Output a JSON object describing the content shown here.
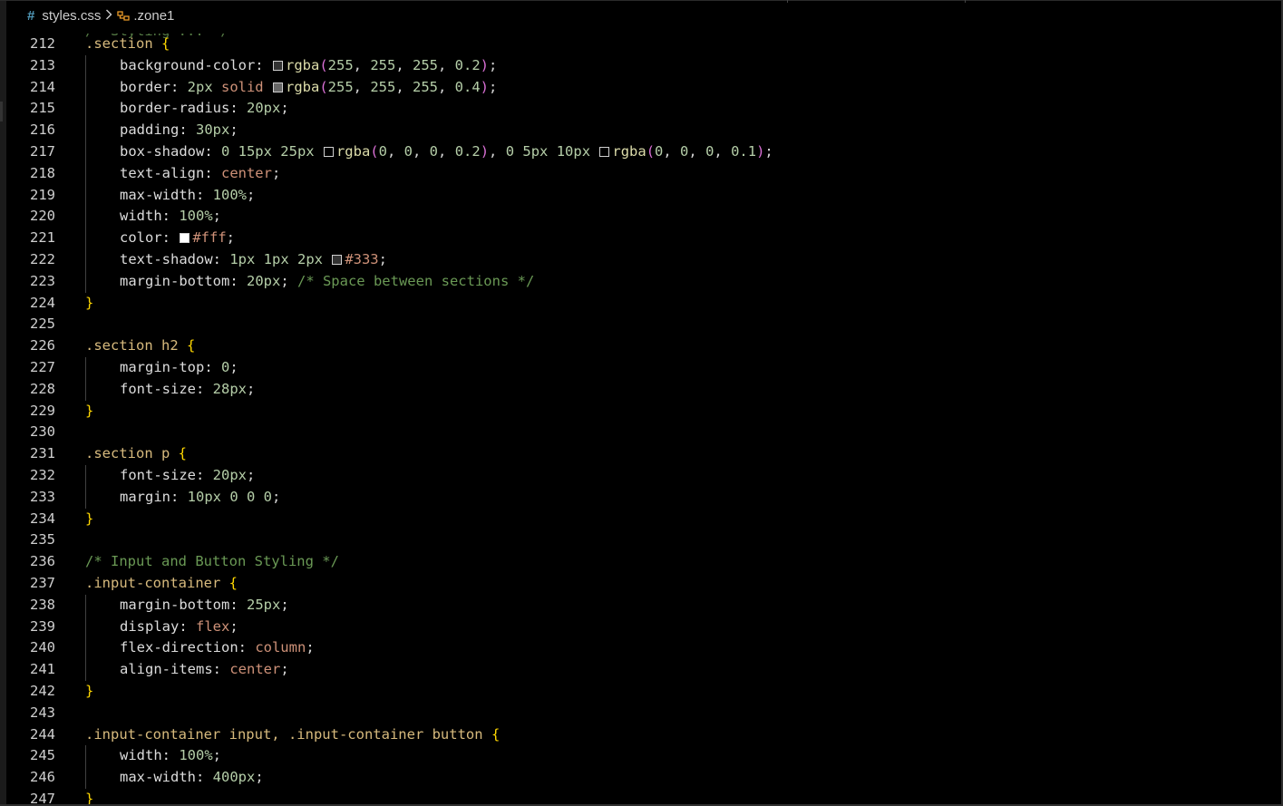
{
  "breadcrumb": {
    "file": "styles.css",
    "symbol": ".zone1"
  },
  "colors": {
    "background": "#000000",
    "selector": "#d7ba7d",
    "brace": "#ffd700",
    "number": "#b5cea8",
    "keyword": "#ce9178",
    "function": "#dcdcaa",
    "comment": "#6a9955"
  },
  "lines": [
    {
      "n": "212",
      "indent": 0,
      "t": [
        [
          "sel",
          ".section "
        ],
        [
          "brace",
          "{"
        ]
      ]
    },
    {
      "n": "213",
      "indent": 1,
      "t": [
        [
          "prop",
          "background-color: "
        ],
        [
          "sw",
          "rgba(255,255,255,0.2)"
        ],
        [
          "fn",
          "rgba"
        ],
        [
          "paren",
          "("
        ],
        [
          "num",
          "255"
        ],
        [
          "punc",
          ", "
        ],
        [
          "num",
          "255"
        ],
        [
          "punc",
          ", "
        ],
        [
          "num",
          "255"
        ],
        [
          "punc",
          ", "
        ],
        [
          "num",
          "0.2"
        ],
        [
          "paren",
          ")"
        ],
        [
          "punc",
          ";"
        ]
      ]
    },
    {
      "n": "214",
      "indent": 1,
      "t": [
        [
          "prop",
          "border: "
        ],
        [
          "num",
          "2px "
        ],
        [
          "kw",
          "solid "
        ],
        [
          "sw",
          "rgba(255,255,255,0.4)"
        ],
        [
          "fn",
          "rgba"
        ],
        [
          "paren",
          "("
        ],
        [
          "num",
          "255"
        ],
        [
          "punc",
          ", "
        ],
        [
          "num",
          "255"
        ],
        [
          "punc",
          ", "
        ],
        [
          "num",
          "255"
        ],
        [
          "punc",
          ", "
        ],
        [
          "num",
          "0.4"
        ],
        [
          "paren",
          ")"
        ],
        [
          "punc",
          ";"
        ]
      ]
    },
    {
      "n": "215",
      "indent": 1,
      "t": [
        [
          "prop",
          "border-radius: "
        ],
        [
          "num",
          "20px"
        ],
        [
          "punc",
          ";"
        ]
      ]
    },
    {
      "n": "216",
      "indent": 1,
      "t": [
        [
          "prop",
          "padding: "
        ],
        [
          "num",
          "30px"
        ],
        [
          "punc",
          ";"
        ]
      ]
    },
    {
      "n": "217",
      "indent": 1,
      "t": [
        [
          "prop",
          "box-shadow: "
        ],
        [
          "num",
          "0 15px 25px "
        ],
        [
          "sw",
          "rgba(0,0,0,0.2)"
        ],
        [
          "fn",
          "rgba"
        ],
        [
          "paren",
          "("
        ],
        [
          "num",
          "0"
        ],
        [
          "punc",
          ", "
        ],
        [
          "num",
          "0"
        ],
        [
          "punc",
          ", "
        ],
        [
          "num",
          "0"
        ],
        [
          "punc",
          ", "
        ],
        [
          "num",
          "0.2"
        ],
        [
          "paren",
          ")"
        ],
        [
          "punc",
          ", "
        ],
        [
          "num",
          "0 5px 10px "
        ],
        [
          "sw",
          "rgba(0,0,0,0.1)"
        ],
        [
          "fn",
          "rgba"
        ],
        [
          "paren",
          "("
        ],
        [
          "num",
          "0"
        ],
        [
          "punc",
          ", "
        ],
        [
          "num",
          "0"
        ],
        [
          "punc",
          ", "
        ],
        [
          "num",
          "0"
        ],
        [
          "punc",
          ", "
        ],
        [
          "num",
          "0.1"
        ],
        [
          "paren",
          ")"
        ],
        [
          "punc",
          ";"
        ]
      ]
    },
    {
      "n": "218",
      "indent": 1,
      "t": [
        [
          "prop",
          "text-align: "
        ],
        [
          "kw",
          "center"
        ],
        [
          "punc",
          ";"
        ]
      ]
    },
    {
      "n": "219",
      "indent": 1,
      "t": [
        [
          "prop",
          "max-width: "
        ],
        [
          "num",
          "100%"
        ],
        [
          "punc",
          ";"
        ]
      ]
    },
    {
      "n": "220",
      "indent": 1,
      "t": [
        [
          "prop",
          "width: "
        ],
        [
          "num",
          "100%"
        ],
        [
          "punc",
          ";"
        ]
      ]
    },
    {
      "n": "221",
      "indent": 1,
      "t": [
        [
          "prop",
          "color: "
        ],
        [
          "sw",
          "#ffffff"
        ],
        [
          "kw",
          "#fff"
        ],
        [
          "punc",
          ";"
        ]
      ]
    },
    {
      "n": "222",
      "indent": 1,
      "t": [
        [
          "prop",
          "text-shadow: "
        ],
        [
          "num",
          "1px 1px 2px "
        ],
        [
          "sw",
          "#333333"
        ],
        [
          "kw",
          "#333"
        ],
        [
          "punc",
          ";"
        ]
      ]
    },
    {
      "n": "223",
      "indent": 1,
      "t": [
        [
          "prop",
          "margin-bottom: "
        ],
        [
          "num",
          "20px"
        ],
        [
          "punc",
          "; "
        ],
        [
          "cmt",
          "/* Space between sections */"
        ]
      ]
    },
    {
      "n": "224",
      "indent": 0,
      "t": [
        [
          "brace",
          "}"
        ]
      ]
    },
    {
      "n": "225",
      "indent": 0,
      "t": []
    },
    {
      "n": "226",
      "indent": 0,
      "t": [
        [
          "sel",
          ".section h2 "
        ],
        [
          "brace",
          "{"
        ]
      ]
    },
    {
      "n": "227",
      "indent": 1,
      "t": [
        [
          "prop",
          "margin-top: "
        ],
        [
          "num",
          "0"
        ],
        [
          "punc",
          ";"
        ]
      ]
    },
    {
      "n": "228",
      "indent": 1,
      "t": [
        [
          "prop",
          "font-size: "
        ],
        [
          "num",
          "28px"
        ],
        [
          "punc",
          ";"
        ]
      ]
    },
    {
      "n": "229",
      "indent": 0,
      "t": [
        [
          "brace",
          "}"
        ]
      ]
    },
    {
      "n": "230",
      "indent": 0,
      "t": []
    },
    {
      "n": "231",
      "indent": 0,
      "t": [
        [
          "sel",
          ".section p "
        ],
        [
          "brace",
          "{"
        ]
      ]
    },
    {
      "n": "232",
      "indent": 1,
      "t": [
        [
          "prop",
          "font-size: "
        ],
        [
          "num",
          "20px"
        ],
        [
          "punc",
          ";"
        ]
      ]
    },
    {
      "n": "233",
      "indent": 1,
      "t": [
        [
          "prop",
          "margin: "
        ],
        [
          "num",
          "10px 0 0 0"
        ],
        [
          "punc",
          ";"
        ]
      ]
    },
    {
      "n": "234",
      "indent": 0,
      "t": [
        [
          "brace",
          "}"
        ]
      ]
    },
    {
      "n": "235",
      "indent": 0,
      "t": []
    },
    {
      "n": "236",
      "indent": 0,
      "t": [
        [
          "cmt",
          "/* Input and Button Styling */"
        ]
      ]
    },
    {
      "n": "237",
      "indent": 0,
      "t": [
        [
          "sel",
          ".input-container "
        ],
        [
          "brace",
          "{"
        ]
      ]
    },
    {
      "n": "238",
      "indent": 1,
      "t": [
        [
          "prop",
          "margin-bottom: "
        ],
        [
          "num",
          "25px"
        ],
        [
          "punc",
          ";"
        ]
      ]
    },
    {
      "n": "239",
      "indent": 1,
      "t": [
        [
          "prop",
          "display: "
        ],
        [
          "kw",
          "flex"
        ],
        [
          "punc",
          ";"
        ]
      ]
    },
    {
      "n": "240",
      "indent": 1,
      "t": [
        [
          "prop",
          "flex-direction: "
        ],
        [
          "kw",
          "column"
        ],
        [
          "punc",
          ";"
        ]
      ]
    },
    {
      "n": "241",
      "indent": 1,
      "t": [
        [
          "prop",
          "align-items: "
        ],
        [
          "kw",
          "center"
        ],
        [
          "punc",
          ";"
        ]
      ]
    },
    {
      "n": "242",
      "indent": 0,
      "t": [
        [
          "brace",
          "}"
        ]
      ]
    },
    {
      "n": "243",
      "indent": 0,
      "t": []
    },
    {
      "n": "244",
      "indent": 0,
      "t": [
        [
          "sel",
          ".input-container input, .input-container button "
        ],
        [
          "brace",
          "{"
        ]
      ]
    },
    {
      "n": "245",
      "indent": 1,
      "t": [
        [
          "prop",
          "width: "
        ],
        [
          "num",
          "100%"
        ],
        [
          "punc",
          ";"
        ]
      ]
    },
    {
      "n": "246",
      "indent": 1,
      "t": [
        [
          "prop",
          "max-width: "
        ],
        [
          "num",
          "400px"
        ],
        [
          "punc",
          ";"
        ]
      ]
    },
    {
      "n": "247",
      "indent": 0,
      "t": [
        [
          "brace",
          "}"
        ]
      ]
    }
  ]
}
